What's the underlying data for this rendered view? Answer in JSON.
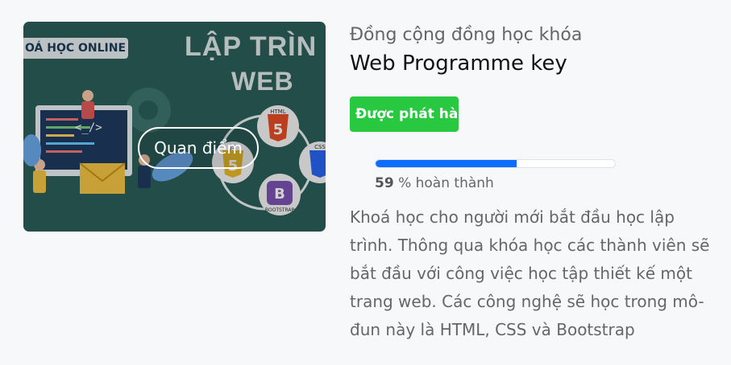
{
  "thumbnail": {
    "banner_text": "OÁ HỌC ONLINE",
    "heading_line1": "LẬP TRÌN",
    "heading_line2": "WEB",
    "code_icon_text": "<_/>",
    "html_label": "HTML",
    "css_label": "CSS",
    "js_label": "JS",
    "bootstrap_label": "BOOTSTRAP",
    "bootstrap_letter": "B",
    "view_button": "Quan điểm"
  },
  "course": {
    "subtitle": "Đồng cộng đồng học khóa",
    "title": "Web Programme key",
    "status_badge": "Được phát hành",
    "progress_percent": 59,
    "progress_value_text": "59",
    "progress_suffix": " % hoàn thành",
    "description": "Khoá học cho người mới bắt đầu học lập trình. Thông qua khóa học các thành viên sẽ bắt đầu với công việc học tập thiết kế một trang web. Các công nghệ sẽ học trong mô-đun này là HTML, CSS và Bootstrap"
  },
  "colors": {
    "badge": "#28c840",
    "progress": "#0d6efd",
    "thumb_bg": "#2b5f5a"
  }
}
